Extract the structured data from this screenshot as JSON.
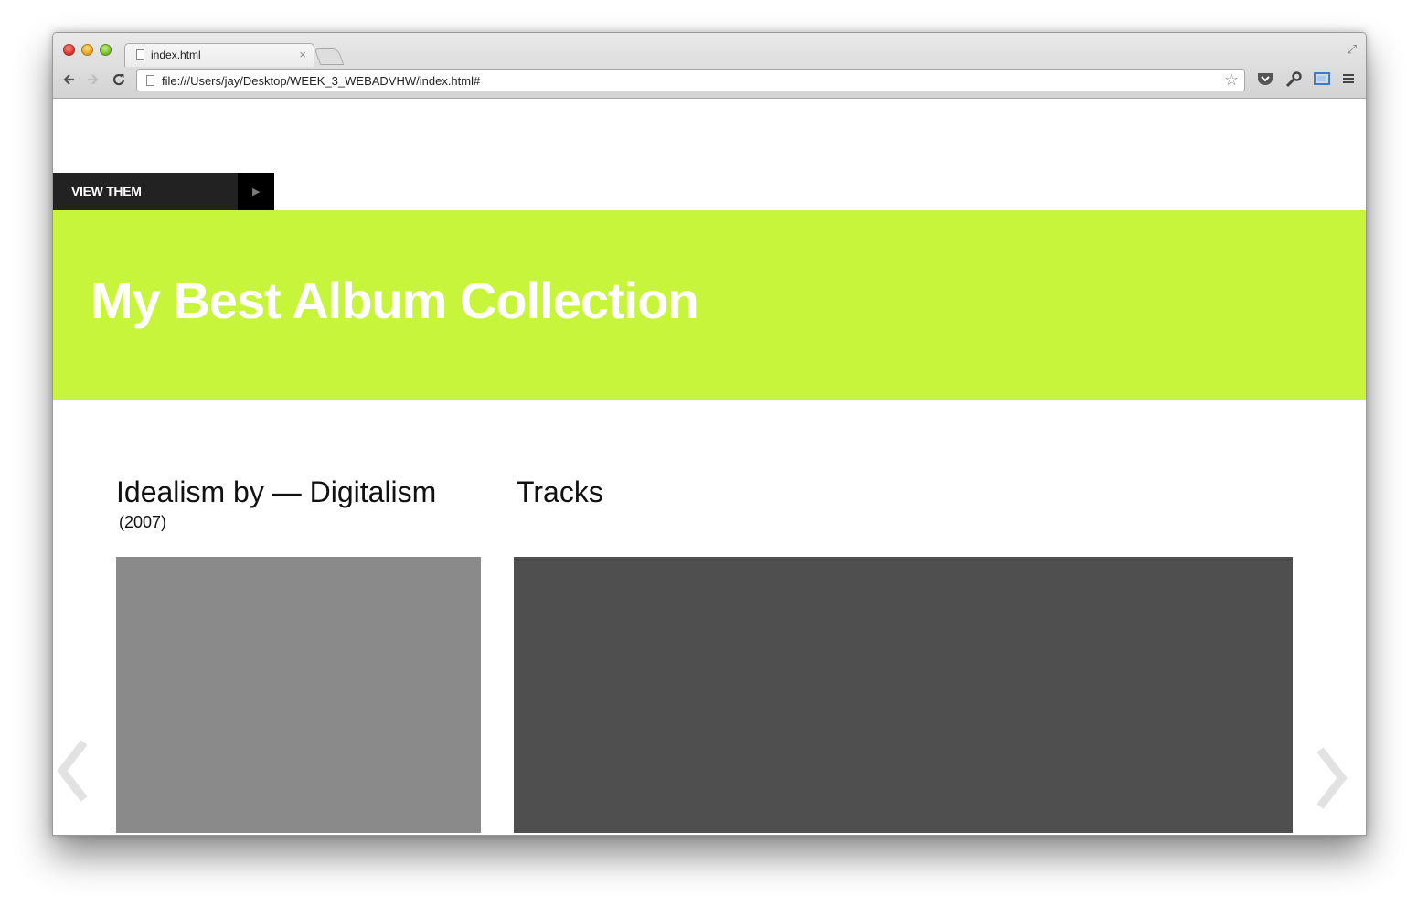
{
  "browser": {
    "tab_title": "index.html",
    "tab_close": "×",
    "url": "file:///Users/jay/Desktop/WEEK_3_WEBADVHW/index.html#"
  },
  "page": {
    "view_them_label": "VIEW THEM",
    "play_glyph": "▶",
    "banner_title": "My Best Album Collection",
    "album_title": "Idealism by — Digitalism",
    "album_year": "(2007)",
    "tracks_title": "Tracks"
  },
  "colors": {
    "banner": "#c6f53c",
    "view_them_bg": "#222222",
    "cover_placeholder": "#8a8a8a",
    "tracks_panel": "#4f4f4f"
  },
  "icons": {
    "back": "arrow-left-icon",
    "forward": "arrow-right-icon",
    "reload": "reload-icon",
    "bookmark": "star-icon",
    "pocket": "pocket-icon",
    "wrench": "wrench-icon",
    "screen": "screen-capture-icon",
    "menu": "hamburger-menu-icon",
    "prev": "chevron-left-icon",
    "next": "chevron-right-icon"
  }
}
